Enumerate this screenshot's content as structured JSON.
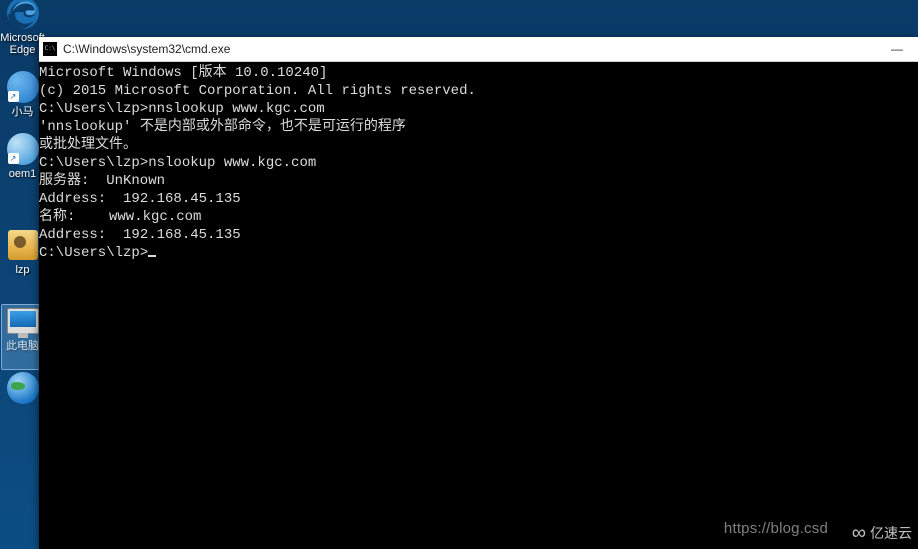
{
  "desktop": {
    "icons": [
      {
        "name": "edge-icon",
        "label": "Microsoft Edge"
      },
      {
        "name": "xiaoma-icon",
        "label": "小马"
      },
      {
        "name": "oem-icon",
        "label": "oem1"
      },
      {
        "name": "user-folder-icon",
        "label": "lzp"
      },
      {
        "name": "this-pc-icon",
        "label": "此电脑"
      },
      {
        "name": "globe-icon",
        "label": ""
      }
    ]
  },
  "cmd": {
    "title": "C:\\Windows\\system32\\cmd.exe",
    "lines": [
      "Microsoft Windows [版本 10.0.10240]",
      "(c) 2015 Microsoft Corporation. All rights reserved.",
      "",
      "C:\\Users\\lzp>nnslookup www.kgc.com",
      "'nnslookup' 不是内部或外部命令，也不是可运行的程序",
      "或批处理文件。",
      "",
      "C:\\Users\\lzp>nslookup www.kgc.com",
      "服务器:  UnKnown",
      "Address:  192.168.45.135",
      "",
      "名称:    www.kgc.com",
      "Address:  192.168.45.135",
      "",
      "",
      "C:\\Users\\lzp>"
    ]
  },
  "watermark": {
    "url": "https://blog.csd",
    "brand": "亿速云"
  }
}
